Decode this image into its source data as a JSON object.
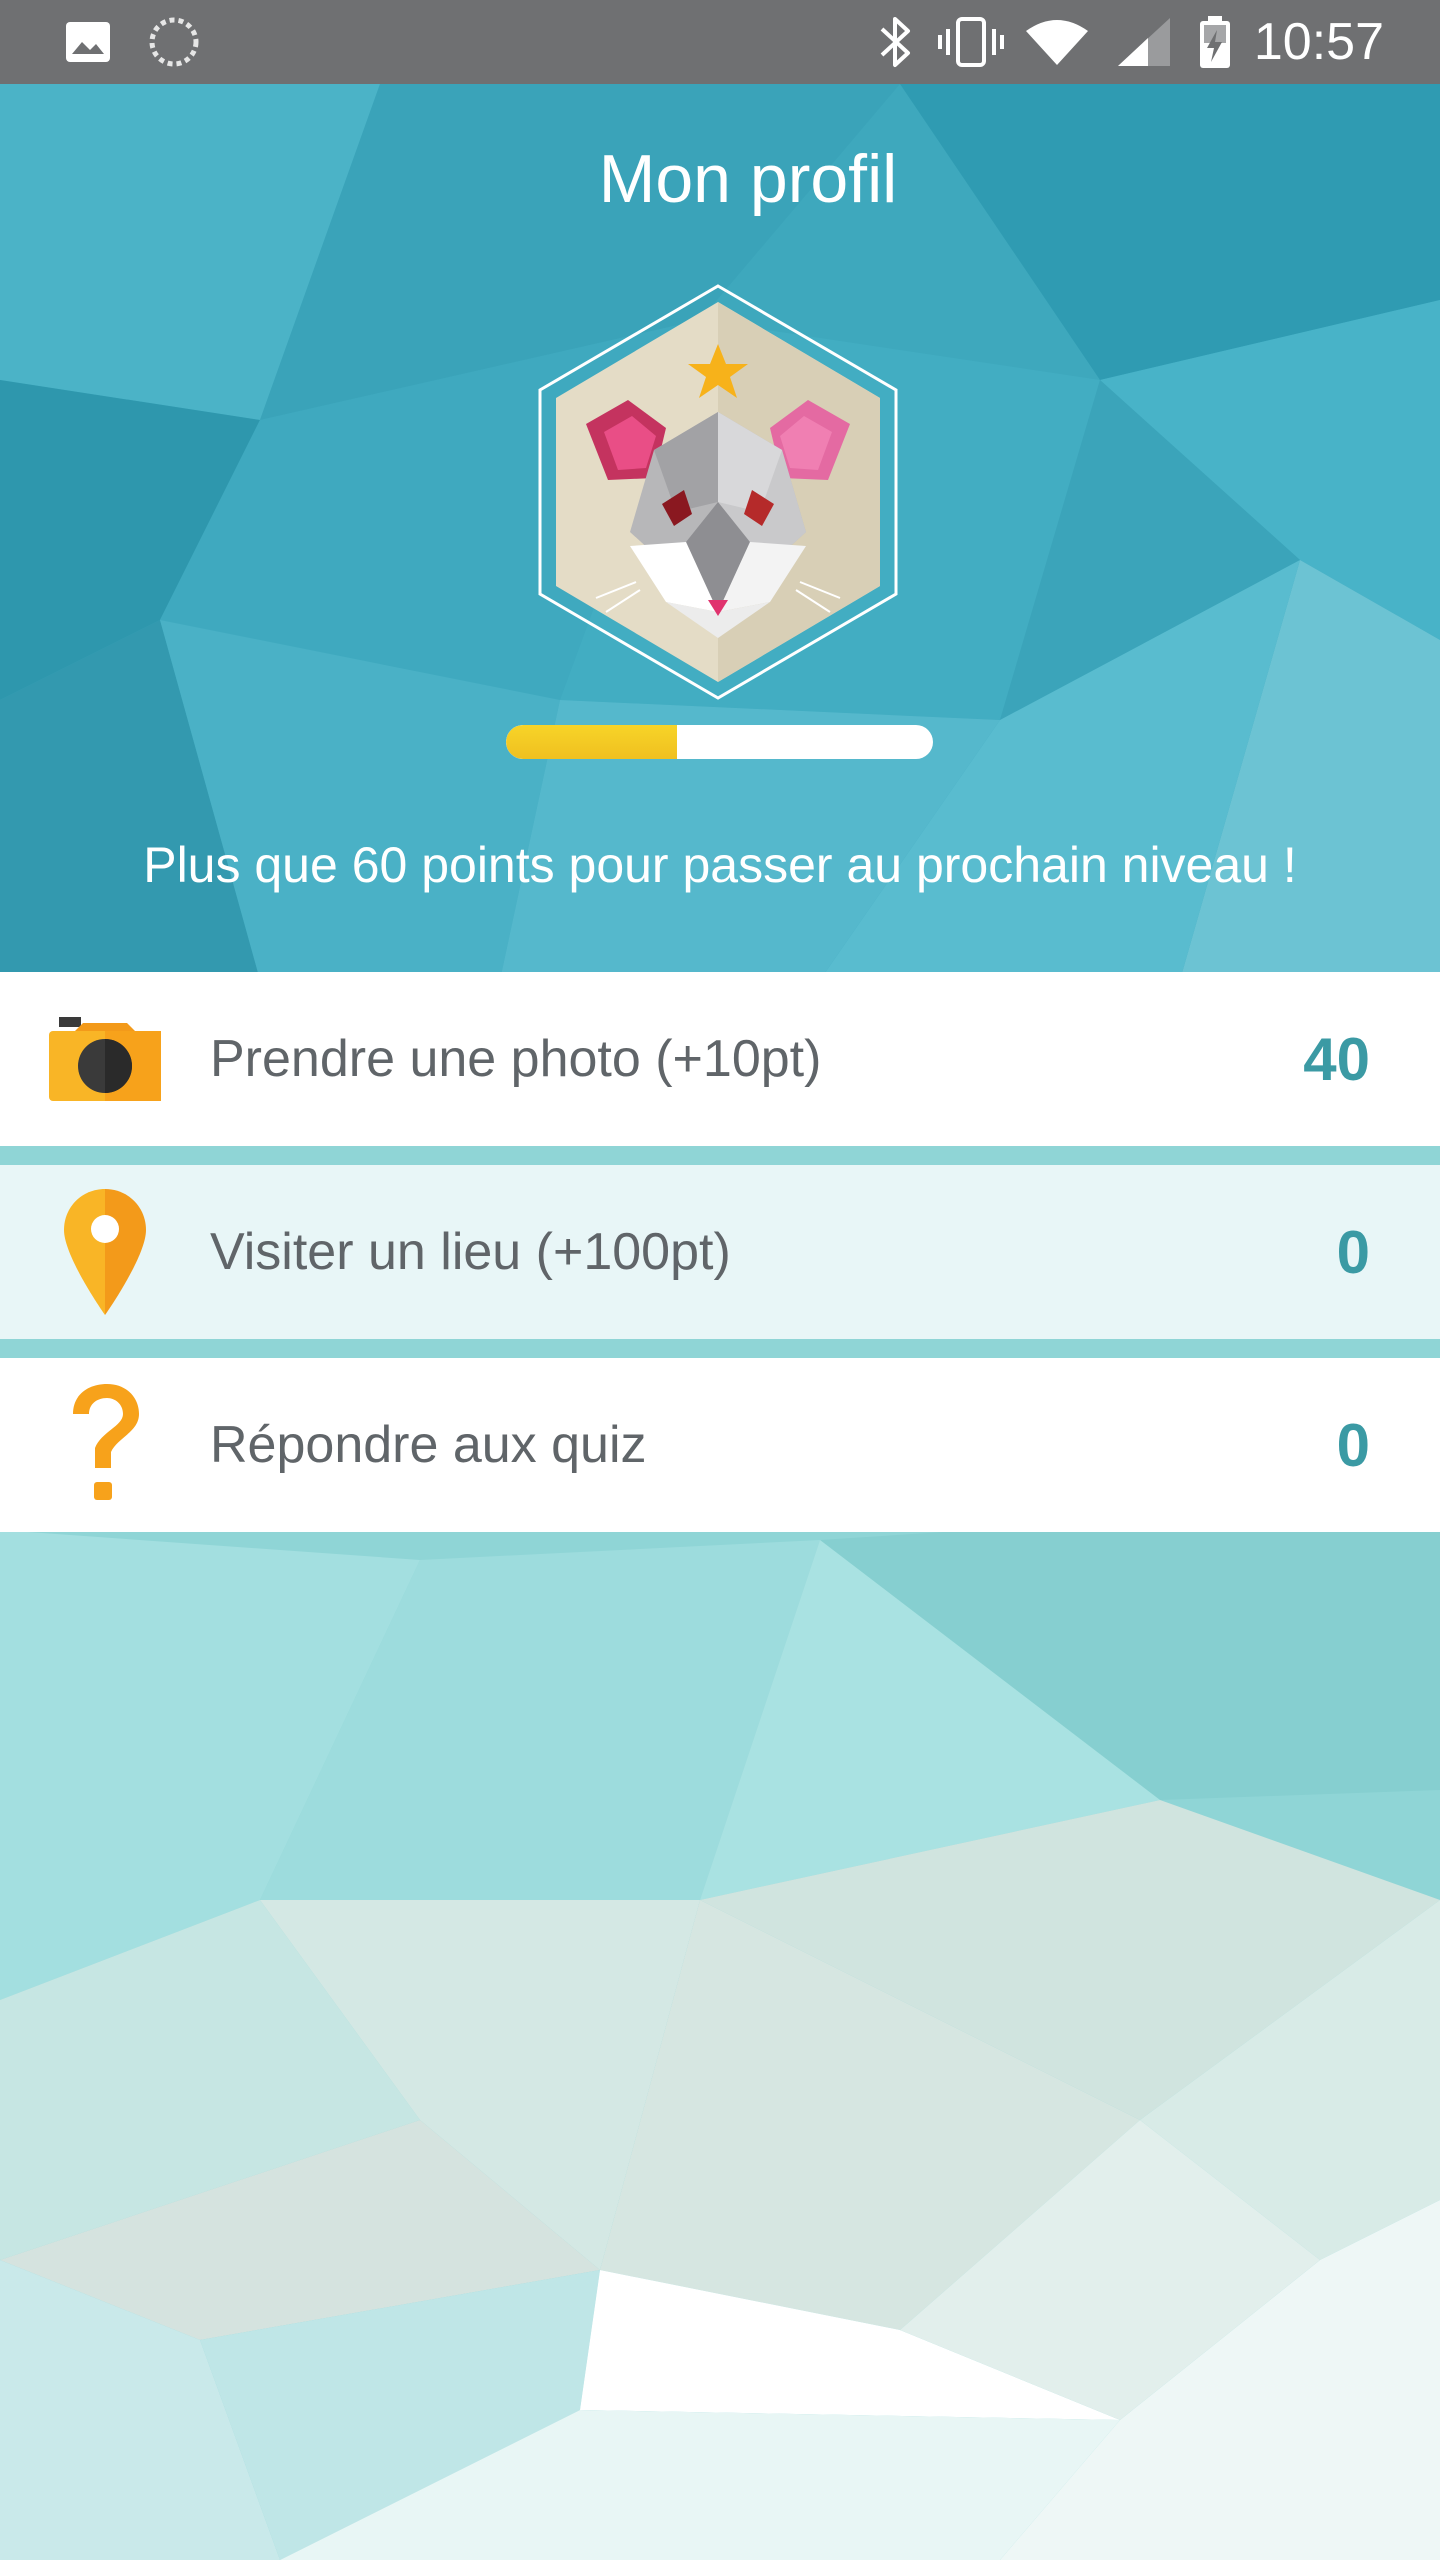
{
  "status_bar": {
    "time": "10:57",
    "icons": [
      "image-icon",
      "loading-icon",
      "bluetooth-icon",
      "vibrate-icon",
      "wifi-icon",
      "cell-signal-icon",
      "battery-charging-icon"
    ]
  },
  "header": {
    "title": "Mon profil",
    "avatar": "mouse-level-badge",
    "progress": 0.4,
    "level_message": "Plus que 60 points pour passer au prochain niveau !"
  },
  "stats": [
    {
      "icon": "camera-icon",
      "label": "Prendre une photo (+10pt)",
      "value": "40"
    },
    {
      "icon": "location-pin-icon",
      "label": "Visiter un lieu (+100pt)",
      "value": "0"
    },
    {
      "icon": "question-mark-icon",
      "label": "Répondre aux quiz",
      "value": "0"
    }
  ],
  "colors": {
    "header_teal": "#3aa7be",
    "progress_yellow": "#f2c822",
    "value_teal": "#3b9aa4",
    "label_gray": "#606569",
    "icon_orange": "#f7a21b"
  }
}
